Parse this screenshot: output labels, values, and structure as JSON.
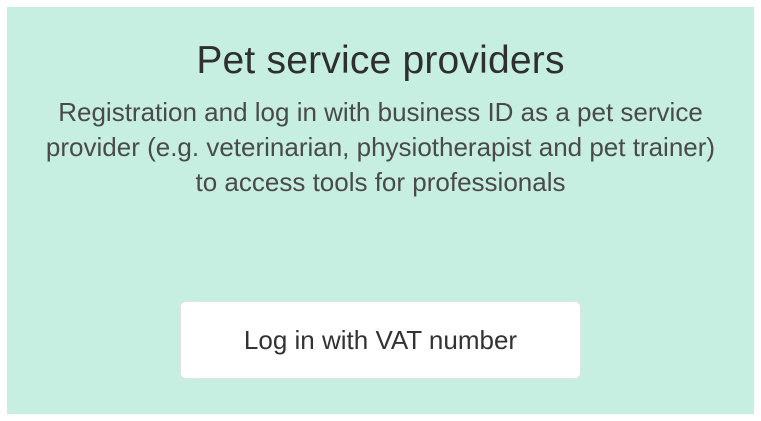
{
  "card": {
    "title": "Pet service providers",
    "description": "Registration and log in with business ID as a pet service provider (e.g. veterinarian, physiotherapist and pet trainer) to access tools for professionals",
    "button_label": "Log in with VAT number"
  },
  "colors": {
    "card_background": "#c6efe1",
    "button_background": "#ffffff",
    "title_text": "#2f2f2f",
    "body_text": "#4a4a4a"
  }
}
